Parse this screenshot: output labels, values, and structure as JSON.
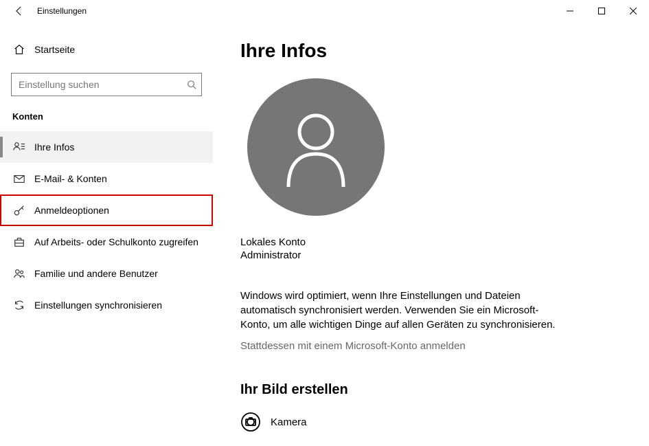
{
  "titlebar": {
    "title": "Einstellungen"
  },
  "sidebar": {
    "home_label": "Startseite",
    "search_placeholder": "Einstellung suchen",
    "section_label": "Konten",
    "items": [
      {
        "label": "Ihre Infos"
      },
      {
        "label": "E-Mail- & Konten"
      },
      {
        "label": "Anmeldeoptionen"
      },
      {
        "label": "Auf Arbeits- oder Schulkonto zugreifen"
      },
      {
        "label": "Familie und andere Benutzer"
      },
      {
        "label": "Einstellungen synchronisieren"
      }
    ]
  },
  "main": {
    "page_title": "Ihre Infos",
    "account_type": "Lokales Konto",
    "account_role": "Administrator",
    "sync_text": "Windows wird optimiert, wenn Ihre Einstellungen und Dateien automatisch synchronisiert werden. Verwenden Sie ein Microsoft-Konto, um alle wichtigen Dinge auf allen Geräten zu synchronisieren.",
    "ms_link": "Stattdessen mit einem Microsoft-Konto anmelden",
    "sub_heading": "Ihr Bild erstellen",
    "camera_label": "Kamera"
  }
}
